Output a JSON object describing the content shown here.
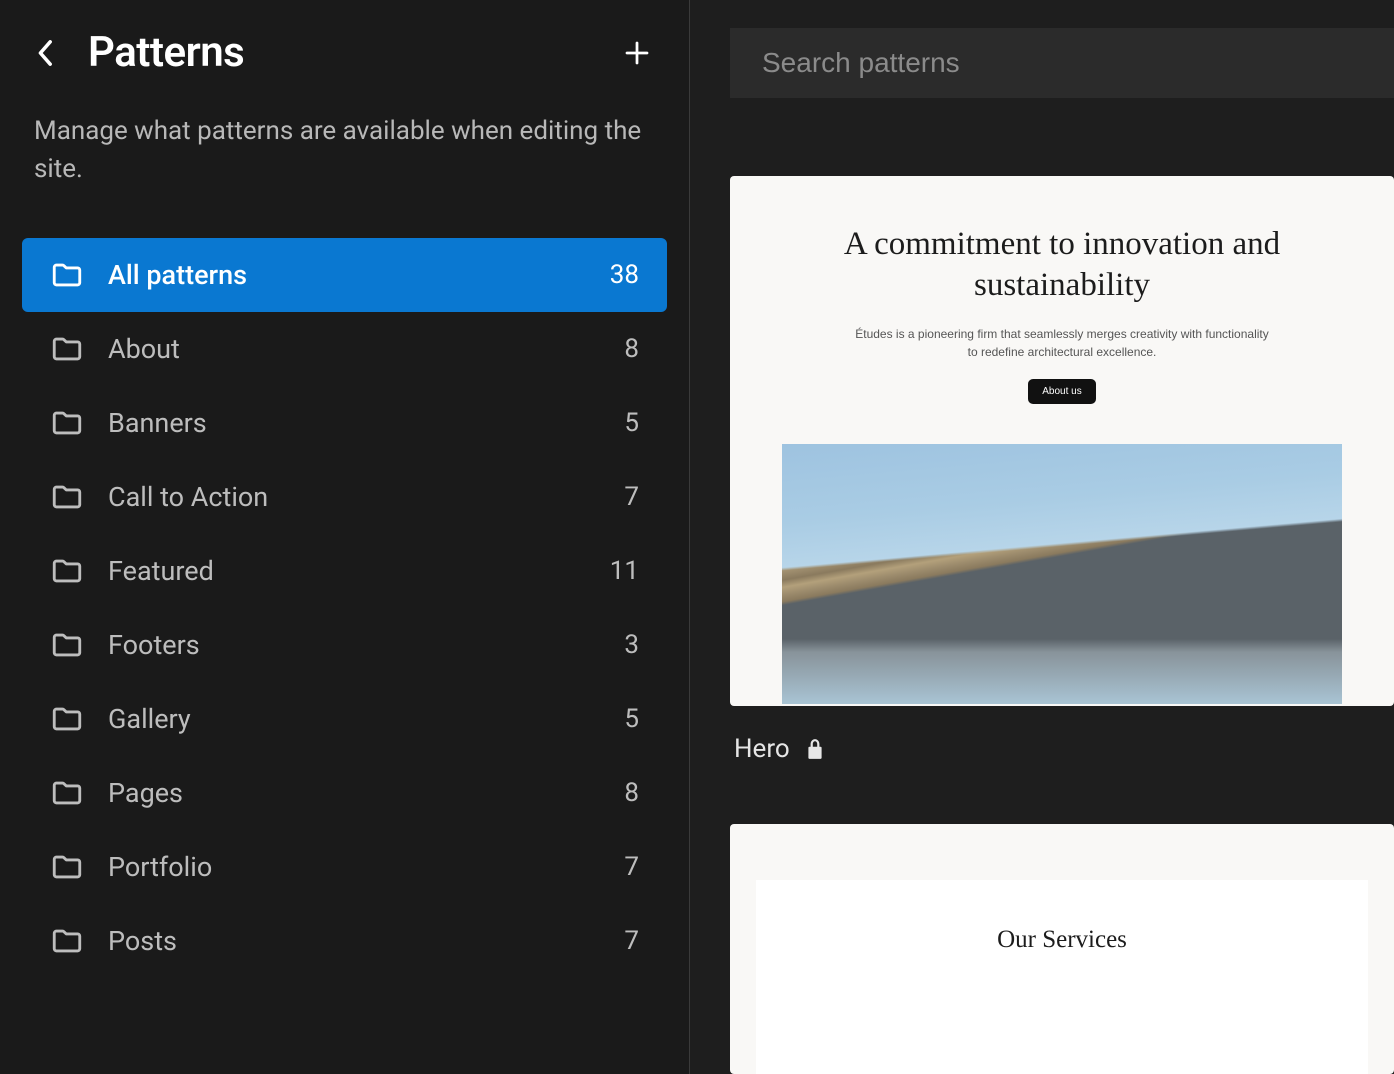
{
  "sidebar": {
    "title": "Patterns",
    "description": "Manage what patterns are available when editing the site.",
    "categories": [
      {
        "label": "All patterns",
        "count": "38",
        "active": true
      },
      {
        "label": "About",
        "count": "8",
        "active": false
      },
      {
        "label": "Banners",
        "count": "5",
        "active": false
      },
      {
        "label": "Call to Action",
        "count": "7",
        "active": false
      },
      {
        "label": "Featured",
        "count": "11",
        "active": false
      },
      {
        "label": "Footers",
        "count": "3",
        "active": false
      },
      {
        "label": "Gallery",
        "count": "5",
        "active": false
      },
      {
        "label": "Pages",
        "count": "8",
        "active": false
      },
      {
        "label": "Portfolio",
        "count": "7",
        "active": false
      },
      {
        "label": "Posts",
        "count": "7",
        "active": false
      }
    ]
  },
  "search": {
    "placeholder": "Search patterns"
  },
  "previews": {
    "hero": {
      "heading": "A commitment to innovation and sustainability",
      "subheading": "Études is a pioneering firm that seamlessly merges creativity with functionality to redefine architectural excellence.",
      "button": "About us",
      "label": "Hero"
    },
    "services": {
      "title": "Our Services"
    }
  }
}
